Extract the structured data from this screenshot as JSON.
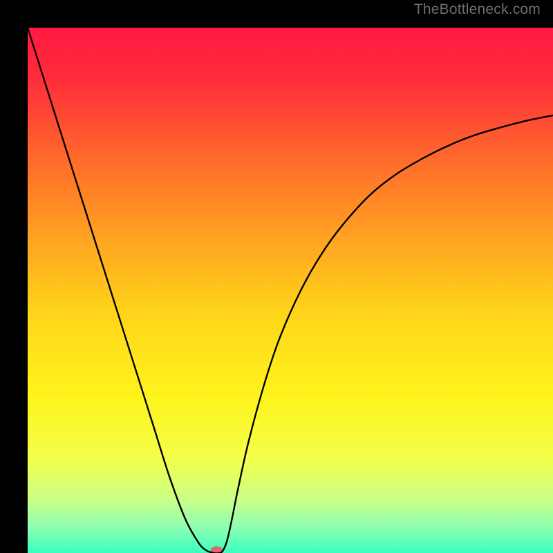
{
  "watermark": {
    "text": "TheBottleneck.com"
  },
  "chart_data": {
    "type": "line",
    "title": "",
    "xlabel": "",
    "ylabel": "",
    "xlim": [
      0,
      100
    ],
    "ylim": [
      0,
      100
    ],
    "legend": false,
    "grid": false,
    "background_gradient": {
      "stops": [
        {
          "offset": 0.0,
          "color": "#ff1a41"
        },
        {
          "offset": 0.1,
          "color": "#ff2d3b"
        },
        {
          "offset": 0.25,
          "color": "#ff6a2b"
        },
        {
          "offset": 0.4,
          "color": "#ffa321"
        },
        {
          "offset": 0.55,
          "color": "#ffd61a"
        },
        {
          "offset": 0.7,
          "color": "#fff31c"
        },
        {
          "offset": 0.82,
          "color": "#f3ff4a"
        },
        {
          "offset": 0.9,
          "color": "#c9ff88"
        },
        {
          "offset": 0.95,
          "color": "#8effb0"
        },
        {
          "offset": 1.0,
          "color": "#3affc0"
        }
      ]
    },
    "series": [
      {
        "name": "bottleneck-curve",
        "color": "#000000",
        "x": [
          0,
          3,
          6,
          9,
          12,
          15,
          18,
          21,
          24,
          27,
          30,
          32.5,
          34,
          35.5,
          36.5,
          37.2,
          38,
          39,
          40,
          42,
          45,
          48,
          52,
          56,
          60,
          65,
          70,
          75,
          80,
          85,
          90,
          95,
          100
        ],
        "y": [
          100,
          90.5,
          81,
          71.5,
          62,
          52.5,
          43,
          33.5,
          24,
          14.5,
          6.5,
          2.0,
          0.5,
          0.0,
          0.0,
          0.5,
          2.5,
          7.0,
          12.0,
          21.0,
          32.0,
          41.0,
          50.0,
          57.0,
          62.5,
          68.0,
          72.0,
          75.0,
          77.5,
          79.5,
          81.0,
          82.3,
          83.3
        ]
      }
    ],
    "marker": {
      "name": "optimal-point",
      "x": 36,
      "y": 0.5,
      "color": "#d86b6b",
      "rx": 9,
      "ry": 6
    }
  }
}
